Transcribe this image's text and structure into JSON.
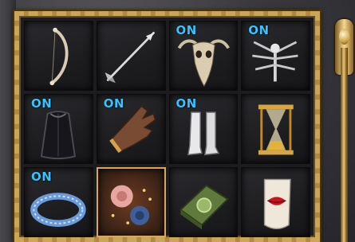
{
  "inventory": {
    "slots": [
      {
        "item": "bow",
        "status": ""
      },
      {
        "item": "arrow",
        "status": ""
      },
      {
        "item": "horned-skull-mask",
        "status": "ON"
      },
      {
        "item": "bone-wings-amulet",
        "status": "ON"
      },
      {
        "item": "dark-cloak",
        "status": "ON"
      },
      {
        "item": "leather-glove",
        "status": "ON"
      },
      {
        "item": "white-boots",
        "status": "ON"
      },
      {
        "item": "hourglass",
        "status": ""
      },
      {
        "item": "rune-ring",
        "status": "ON"
      },
      {
        "item": "roses-bouquet",
        "status": "",
        "selected": true
      },
      {
        "item": "green-spellbook",
        "status": ""
      },
      {
        "item": "lips-scroll",
        "status": ""
      }
    ]
  },
  "colors": {
    "on_badge": "#36c3ff",
    "frame_gold": "#b08a45",
    "selected_border": "#d9a660"
  }
}
